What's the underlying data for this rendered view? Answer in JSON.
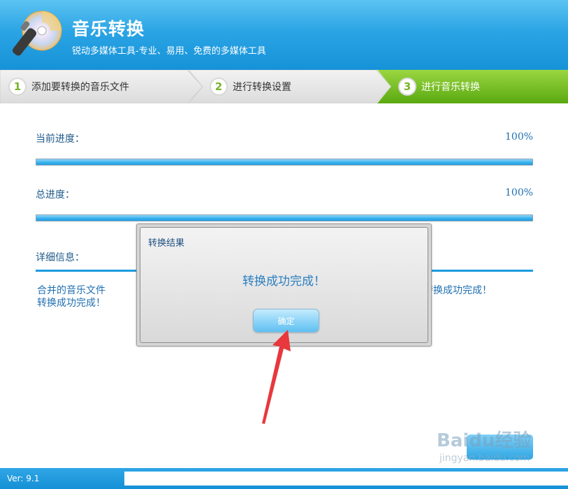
{
  "header": {
    "title": "音乐转换",
    "subtitle": "锐动多媒体工具-专业、易用、免费的多媒体工具",
    "logo_icon": "cd-logo-icon"
  },
  "steps": [
    {
      "num": "1",
      "label": "添加要转换的音乐文件",
      "active": false
    },
    {
      "num": "2",
      "label": "进行转换设置",
      "active": false
    },
    {
      "num": "3",
      "label": "进行音乐转换",
      "active": true
    }
  ],
  "progress": {
    "current_label": "当前进度：",
    "current_value": "100%",
    "current_fraction": 1.0,
    "total_label": "总进度：",
    "total_value": "100%",
    "total_fraction": 1.0
  },
  "details": {
    "label": "详细信息：",
    "left_line1": "合并的音乐文件",
    "left_line2": "转换成功完成！",
    "right_text": "转换成功完成！"
  },
  "dialog": {
    "title": "转换结果",
    "message": "转换成功完成！",
    "ok_label": "确定"
  },
  "footer": {
    "version": "Ver: 9.1"
  },
  "watermark": {
    "text": "Baidu经验",
    "url": "jingyan.baidu.com"
  },
  "colors": {
    "header_blue": "#1692d8",
    "active_step_green": "#6ab51c",
    "progress_blue": "#219fe2",
    "arrow_red": "#e8383d"
  }
}
